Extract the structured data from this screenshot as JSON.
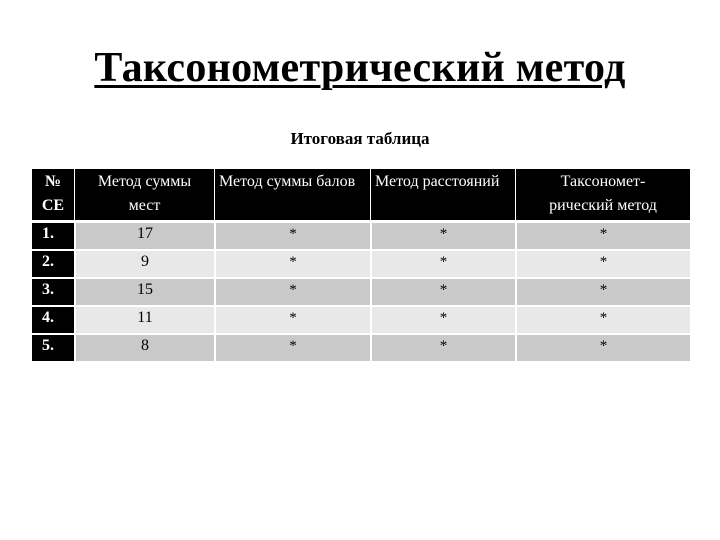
{
  "title": "Таксонометрический метод",
  "subtitle": "Итоговая таблица",
  "table": {
    "headers": [
      {
        "line1": "№",
        "line2": "СЕ"
      },
      {
        "line1": "Метод суммы",
        "line2": "мест"
      },
      {
        "line1": "Метод суммы балов",
        "line2": ""
      },
      {
        "line1": "Метод расстояний",
        "line2": ""
      },
      {
        "line1": "Таксономет-",
        "line2": "рический метод"
      }
    ],
    "rows": [
      [
        "1.",
        "17",
        "*",
        "*",
        "*"
      ],
      [
        "2.",
        "9",
        "*",
        "*",
        "*"
      ],
      [
        "3.",
        "15",
        "*",
        "*",
        "*"
      ],
      [
        "4.",
        "11",
        "*",
        "*",
        "*"
      ],
      [
        "5.",
        "8",
        "*",
        "*",
        "*"
      ]
    ]
  }
}
